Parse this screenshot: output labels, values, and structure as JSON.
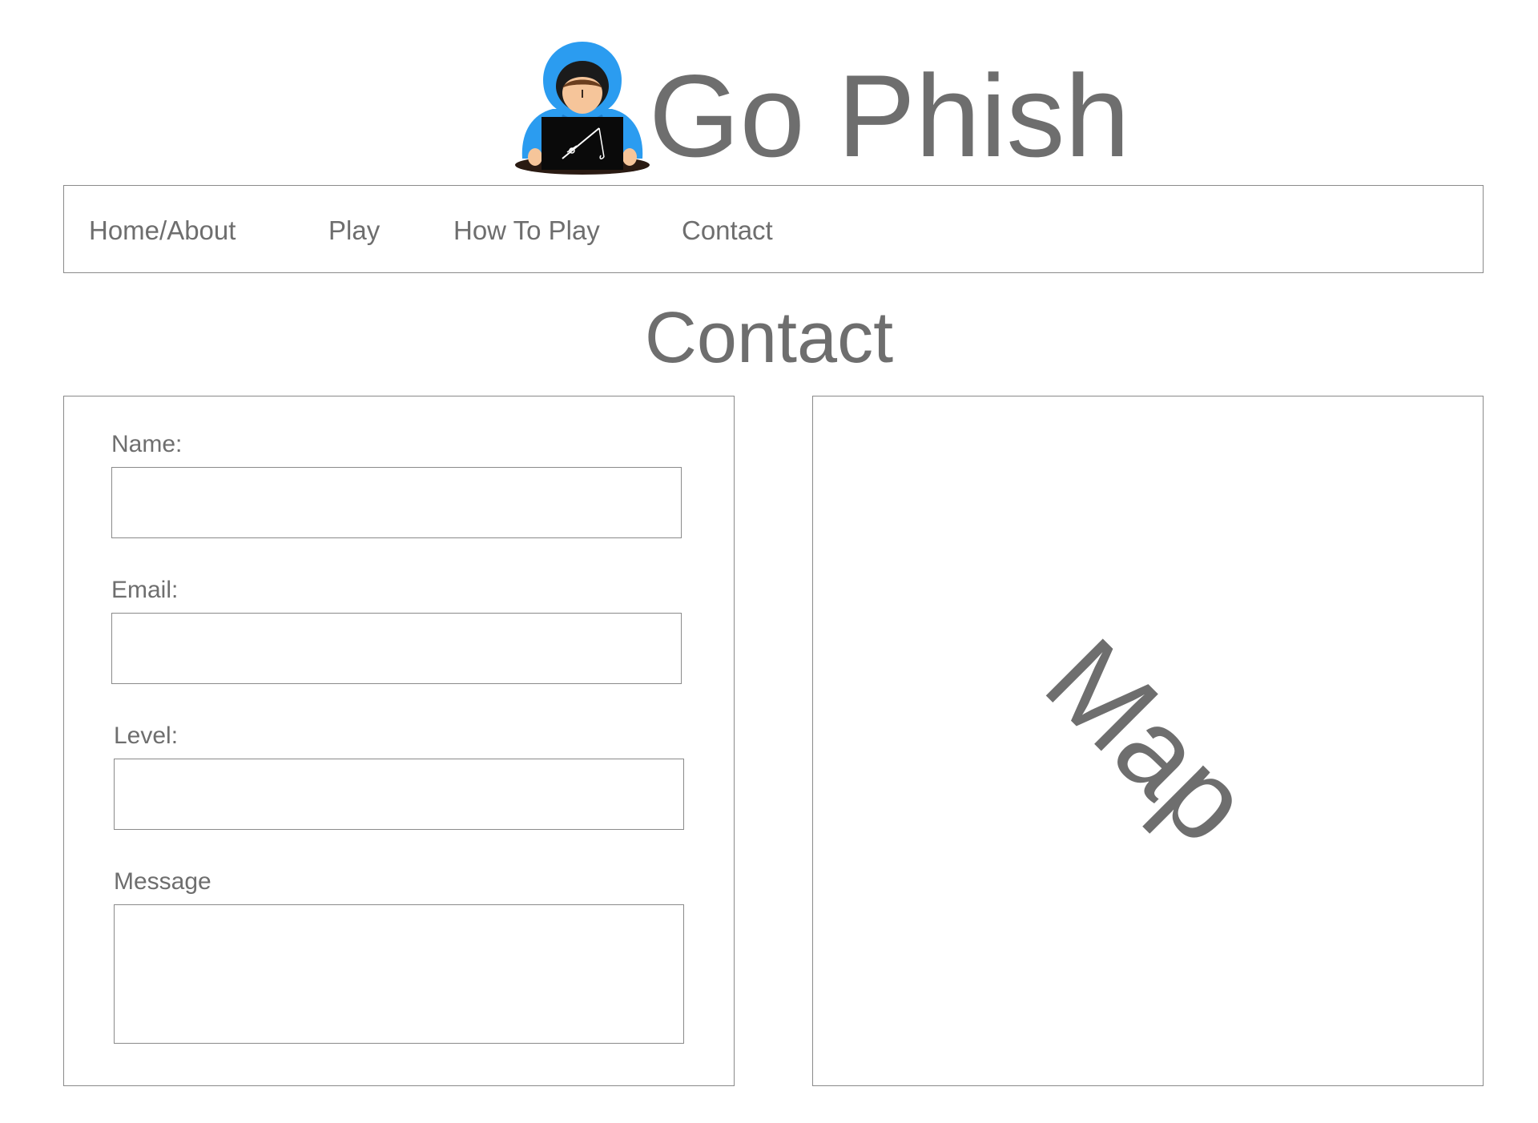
{
  "header": {
    "title": "Go Phish",
    "logo_icon": "hooded-hacker-laptop-fishing-rod-icon"
  },
  "nav": {
    "items": [
      {
        "label": "Home/About"
      },
      {
        "label": "Play"
      },
      {
        "label": "How To Play"
      },
      {
        "label": "Contact"
      }
    ]
  },
  "page": {
    "title": "Contact"
  },
  "form": {
    "name_label": "Name:",
    "name_value": "",
    "email_label": "Email:",
    "email_value": "",
    "level_label": "Level:",
    "level_value": "",
    "message_label": "Message",
    "message_value": ""
  },
  "map": {
    "placeholder": "Map"
  },
  "colors": {
    "text": "#6e6e6e",
    "border": "#8a8a8a",
    "hood": "#2b9cf0",
    "laptop": "#0a0a0a",
    "skin": "#f6c59a"
  }
}
